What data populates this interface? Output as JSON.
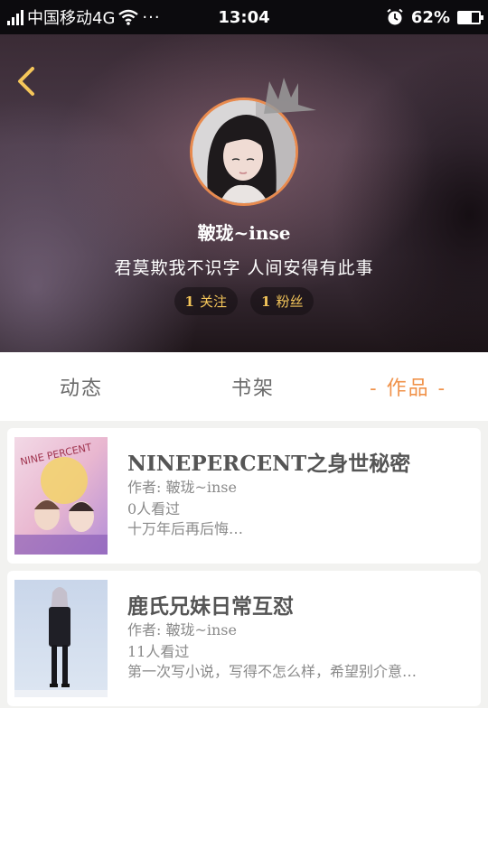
{
  "status_bar": {
    "carrier": "中国移动4G",
    "more": "···",
    "time": "13:04",
    "battery_percent": "62%",
    "battery_level": 0.62,
    "icons": [
      "signal-icon",
      "wifi-icon",
      "alarm-icon",
      "battery-icon"
    ]
  },
  "profile": {
    "username": "鞁珑~inse",
    "signature": "君莫欺我不识字 人间安得有此事",
    "following_count": "1",
    "following_label": "关注",
    "followers_count": "1",
    "followers_label": "粉丝",
    "accent_color": "#e88a4e"
  },
  "tabs": [
    {
      "label": "动态",
      "active": false
    },
    {
      "label": "书架",
      "active": false
    },
    {
      "label": "- 作品 -",
      "active": true
    }
  ],
  "works": [
    {
      "title": "NINEPERCENT之身世秘密",
      "author": "作者: 鞁珑~inse",
      "views": "0人看过",
      "description": "十万年后再后悔…",
      "cover_text": "NINE PERCENT"
    },
    {
      "title": "鹿氏兄妹日常互怼",
      "author": "作者: 鞁珑~inse",
      "views": "11人看过",
      "description": "第一次写小说，写得不怎么样，希望别介意…"
    }
  ]
}
